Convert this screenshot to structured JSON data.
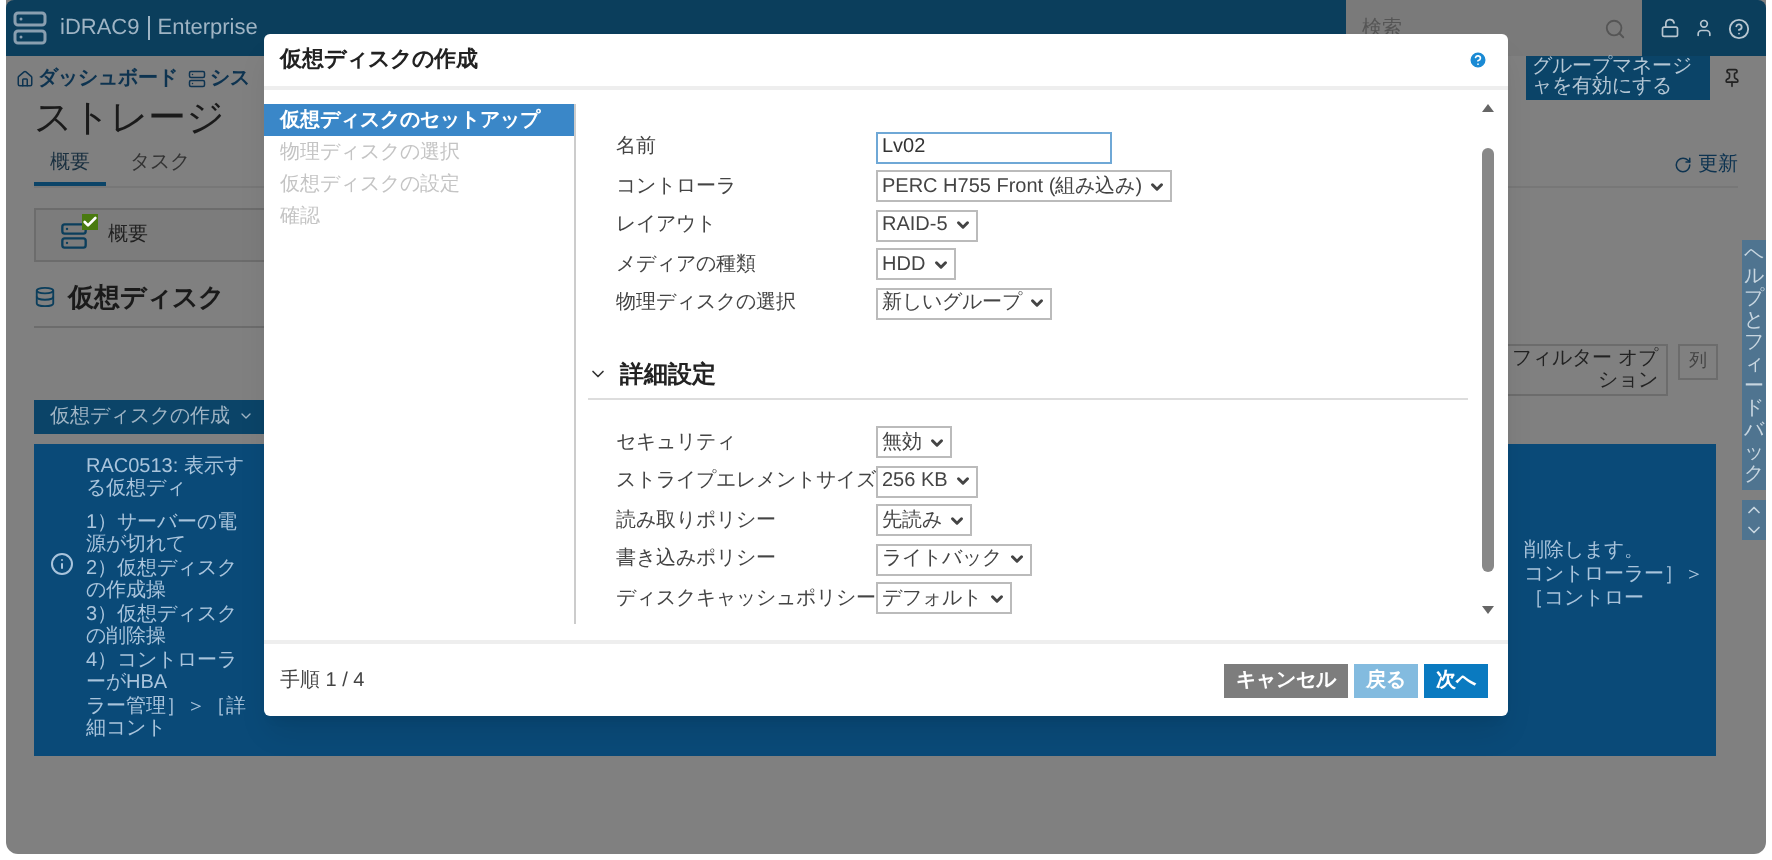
{
  "top_bar": {
    "product": "iDRAC9",
    "edition": "Enterprise",
    "search": {
      "placeholder": "検索"
    }
  },
  "nav": [
    {
      "label": "ダッシュボード",
      "kind": "home"
    },
    {
      "label": "シス",
      "kind": "system"
    }
  ],
  "group_manager_button": "グループマネージャを有効にする",
  "page": {
    "title": "ストレージ",
    "tabs": [
      {
        "label": "概要",
        "selected": true
      },
      {
        "label": "タスク",
        "selected": false
      }
    ],
    "refresh": "更新",
    "summary_card": "概要",
    "section_title": "仮想ディスク",
    "create_button": "仮想ディスクの作成",
    "filter_button": "フィルター オプション",
    "columns_button": "列",
    "info": {
      "left_lines": [
        "RAC0513: 表示する仮想ディ",
        "1）サーバーの電源が切れて",
        "2）仮想ディスクの作成操",
        "3）仮想ディスクの削除操",
        "4）コントローラーがHBA",
        "ラー管理］＞［詳細コント"
      ],
      "right_lines": [
        "削除します。",
        "コントローラー］＞［コントロー"
      ]
    }
  },
  "side_tab": "ヘルプとフィードバック",
  "dialog": {
    "title": "仮想ディスクの作成",
    "steps": [
      {
        "label": "仮想ディスクのセットアップ",
        "selected": true
      },
      {
        "label": "物理ディスクの選択",
        "selected": false
      },
      {
        "label": "仮想ディスクの設定",
        "selected": false
      },
      {
        "label": "確認",
        "selected": false
      }
    ],
    "fields": [
      {
        "label": "名前",
        "kind": "text",
        "value": "Lv02"
      },
      {
        "label": "コントローラ",
        "kind": "select",
        "value": "PERC H755 Front (組み込み)"
      },
      {
        "label": "レイアウト",
        "kind": "select",
        "value": "RAID-5"
      },
      {
        "label": "メディアの種類",
        "kind": "select",
        "value": "HDD"
      },
      {
        "label": "物理ディスクの選択",
        "kind": "select",
        "value": "新しいグループ"
      }
    ],
    "advanced": {
      "title": "詳細設定",
      "expanded": true,
      "fields": [
        {
          "label": "セキュリティ",
          "kind": "select",
          "value": "無効"
        },
        {
          "label": "ストライプエレメントサイズ",
          "kind": "select",
          "value": "256 KB"
        },
        {
          "label": "読み取りポリシー",
          "kind": "select",
          "value": "先読み"
        },
        {
          "label": "書き込みポリシー",
          "kind": "select",
          "value": "ライトバック"
        },
        {
          "label": "ディスクキャッシュポリシー",
          "kind": "select",
          "value": "デフォルト"
        }
      ]
    },
    "step_counter": "手順 1 / 4",
    "buttons": [
      {
        "label": "キャンセル",
        "kind": "cancel",
        "disabled": false
      },
      {
        "label": "戻る",
        "kind": "back",
        "disabled": true
      },
      {
        "label": "次へ",
        "kind": "next",
        "disabled": false
      }
    ]
  }
}
